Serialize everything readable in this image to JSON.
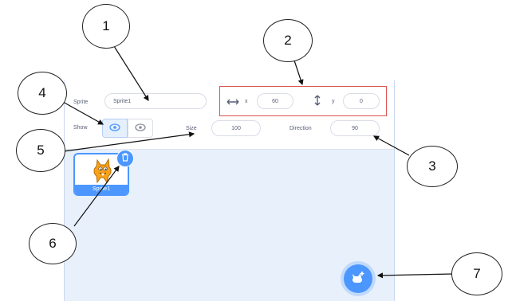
{
  "sprite_info": {
    "sprite_label": "Sprite",
    "sprite_name": "Sprite1",
    "x_label": "x",
    "x_value": "60",
    "y_label": "y",
    "y_value": "0",
    "show_label": "Show",
    "size_label": "Size",
    "size_value": "100",
    "direction_label": "Direction",
    "direction_value": "90"
  },
  "sprite_list": [
    {
      "name": "Sprite1",
      "selected": true
    }
  ],
  "callouts": [
    "1",
    "2",
    "3",
    "4",
    "5",
    "6",
    "7"
  ],
  "colors": {
    "accent": "#4c97ff",
    "highlight_box": "#d9534f",
    "pane_bg": "#e8f0fb"
  },
  "icons": [
    "x-arrows-icon",
    "y-arrows-icon",
    "show-visible-icon",
    "show-hidden-icon",
    "delete-sprite-icon",
    "choose-sprite-icon",
    "cat-sprite-thumbnail"
  ]
}
